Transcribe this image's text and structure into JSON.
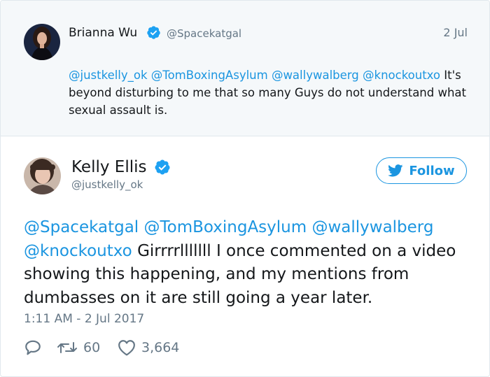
{
  "quoted_tweet": {
    "author_name": "Brianna Wu",
    "author_handle": "@Spacekatgal",
    "date": "2 Jul",
    "mentions": "@justkelly_ok @TomBoxingAsylum @wallywalberg @knockoutxo",
    "text": " It's beyond disturbing to me that so many Guys do not understand what sexual assault is."
  },
  "main_tweet": {
    "author_name": "Kelly Ellis",
    "author_handle": "@justkelly_ok",
    "follow_label": "Follow",
    "mentions": "@Spacekatgal @TomBoxingAsylum @wallywalberg @knockoutxo",
    "text": " Girrrrlllllll I once commented on a video showing this happening, and my mentions from dumbasses on it are still going a year later.",
    "timestamp": "1:11 AM - 2 Jul 2017",
    "retweet_count": "60",
    "like_count": "3,664"
  },
  "colors": {
    "link": "#1b95e0",
    "muted": "#657786",
    "reply_bg": "#f5f8fa"
  },
  "icons": [
    "verified-badge-icon",
    "twitter-bird-icon",
    "reply-icon",
    "retweet-icon",
    "heart-icon"
  ]
}
